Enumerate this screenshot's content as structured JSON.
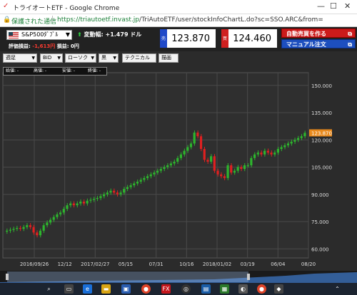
{
  "browser": {
    "title": "トライオートETF - Google Chrome",
    "security_label": "保護された通信",
    "url_host": "https://triautoetf.invast.jp",
    "url_path": "/TriAutoETF/user/stockInfoChartL.do?sc=SSO.ARC&from="
  },
  "header": {
    "symbol": "S&P500ﾀﾞﾌﾞﾙ",
    "change_label": "変動幅:",
    "change_value": "+1.479 ドル",
    "eval_label": "評価損益:",
    "eval_value": "-1,613円",
    "pl_label": "損益:",
    "pl_value": "0円",
    "sell_tag": "売",
    "sell_price": "123.870",
    "buy_tag": "買",
    "buy_price": "124.460",
    "auto_order": "自動売買を作る",
    "manual_order": "マニュアル注文"
  },
  "toolbar": {
    "period": "週足",
    "side": "BID",
    "style": "ローソク",
    "color": "黒",
    "technical": "テクニカル",
    "drawing": "描画"
  },
  "ohlc": {
    "open": "始値: -",
    "high": "高値: -",
    "low": "安値: -",
    "close": "終値: -"
  },
  "colors": {
    "up": "#2db52d",
    "down": "#e02020",
    "current": "#e8891c"
  },
  "chart_data": {
    "type": "candlestick",
    "y_ticks": [
      "150.000",
      "135.000",
      "120.000",
      "105.000",
      "90.000",
      "75.000",
      "60.000"
    ],
    "ylim": [
      55,
      157
    ],
    "x_ticks": [
      "2016/09/26",
      "12/12",
      "2017/02/27",
      "05/15",
      "07/31",
      "10/16",
      "2018/01/02",
      "03/19",
      "06/04",
      "08/20"
    ],
    "current_price": "123.870",
    "close_series": [
      70,
      70.5,
      71,
      71.5,
      71,
      72,
      73,
      72,
      69,
      67.5,
      70,
      73,
      74.5,
      76,
      77.5,
      79,
      80,
      82,
      84,
      85,
      84,
      85,
      86,
      85,
      86.5,
      87,
      87.5,
      88,
      89,
      90,
      91,
      92,
      91,
      90,
      91,
      93,
      94,
      95,
      96,
      97,
      98,
      99,
      100,
      101,
      102,
      103,
      104,
      105,
      106,
      107,
      108,
      110,
      112,
      114,
      116,
      118,
      124,
      122,
      115,
      109,
      108,
      111,
      103,
      101,
      100,
      99,
      106,
      102,
      103,
      105,
      104,
      106,
      106,
      110,
      112,
      113,
      112,
      114,
      113,
      112,
      113,
      115,
      116,
      117,
      118,
      119,
      120,
      121,
      122,
      123.87
    ]
  }
}
